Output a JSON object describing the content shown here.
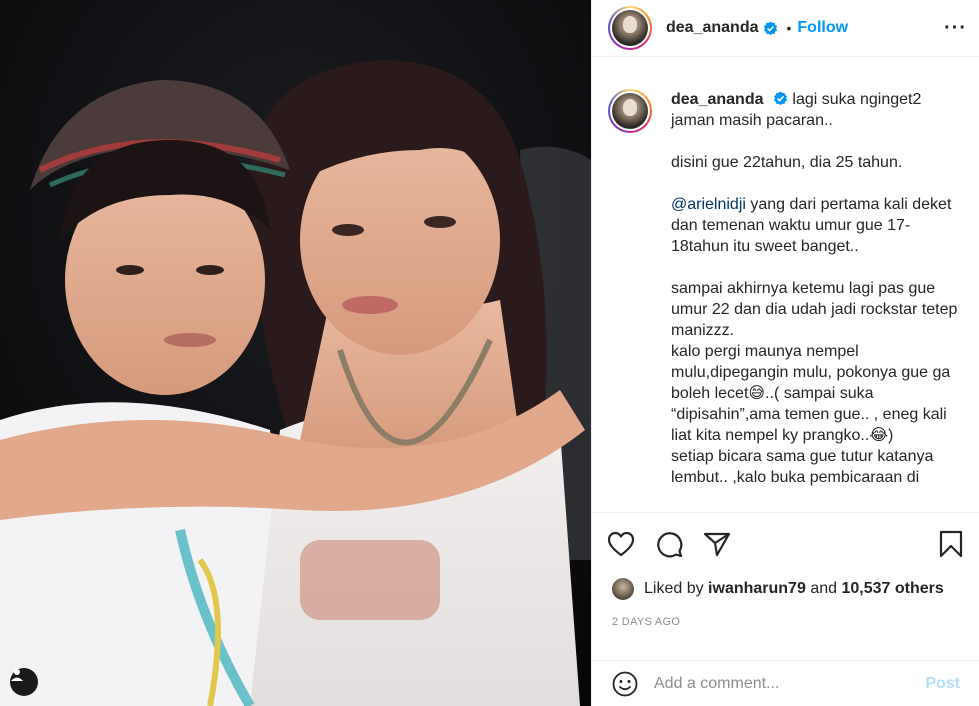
{
  "post": {
    "username": "dea_ananda",
    "verified": true,
    "separator": "•",
    "follow_label": "Follow",
    "more_icon": "more-horizontal-icon"
  },
  "caption": {
    "username": "dea_ananda",
    "lines": {
      "p1": "lagi suka nginget2 jaman masih pacaran..",
      "p2": "disini gue 22tahun, dia 25 tahun.",
      "p3_mention": "@arielnidji",
      "p3_rest": " yang dari pertama kali deket dan temenan waktu umur gue 17-18tahun itu sweet banget..",
      "p4": "sampai akhirnya ketemu lagi pas gue umur 22 dan dia udah jadi rockstar tetep manizzz.",
      "p5a": "kalo pergi maunya nempel mulu,dipegangin mulu, pokonya gue ga boleh lecet",
      "emoji1": "😅",
      "p5b": "..( sampai suka “dipisahin”,ama temen gue.. , eneg kali liat kita nempel ky prangko..",
      "emoji2": "😂",
      "p5c": ")",
      "p6": "setiap bicara sama gue tutur katanya lembut.. ,kalo buka pembicaraan di"
    }
  },
  "actions": {
    "like_icon": "heart-icon",
    "comment_icon": "comment-icon",
    "share_icon": "share-icon",
    "save_icon": "bookmark-icon"
  },
  "likes": {
    "prefix": "Liked by ",
    "user": "iwanharun79",
    "middle": " and ",
    "count": "10,537 others"
  },
  "timestamp": "2 DAYS AGO",
  "comment": {
    "placeholder": "Add a comment...",
    "post_label": "Post"
  },
  "colors": {
    "accent": "#0095f6",
    "post_disabled": "#b2dffc",
    "mention": "#00376b",
    "muted": "#8e8e8e"
  }
}
